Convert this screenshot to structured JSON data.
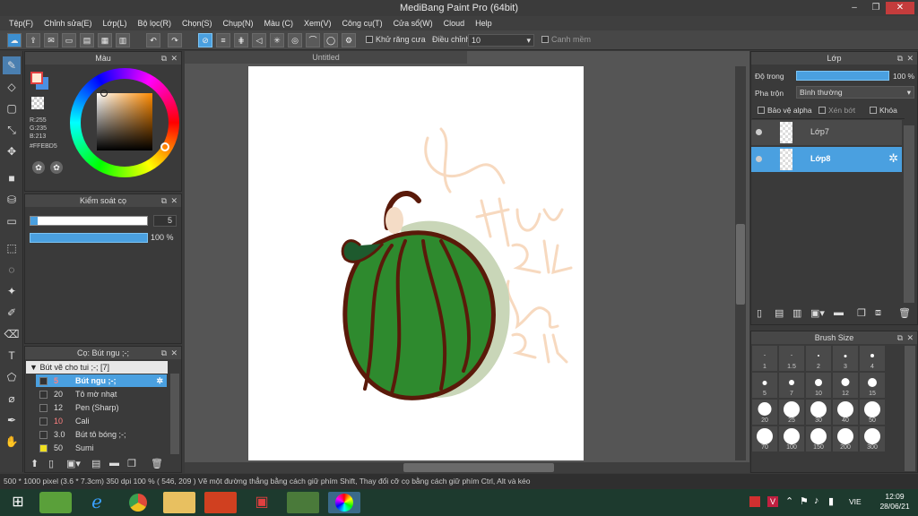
{
  "window": {
    "title": "MediBang Paint Pro (64bit)",
    "min": "–",
    "max": "❐",
    "close": "✕"
  },
  "menu": [
    "Tệp(F)",
    "Chỉnh sửa(E)",
    "Lớp(L)",
    "Bộ lọc(R)",
    "Chọn(S)",
    "Chụp(N)",
    "Màu (C)",
    "Xem(V)",
    "Công cụ(T)",
    "Cửa sổ(W)",
    "Cloud",
    "Help"
  ],
  "toolbar": {
    "antialias_label": "Khử răng cưa",
    "adjust_label": "Điều chỉnh",
    "adjust_value": "10",
    "align_label": "Canh mềm"
  },
  "color_panel": {
    "title": "Màu",
    "r": "R:255",
    "g": "G:235",
    "b": "B:213",
    "hex": "#FFEBD5",
    "fg": "#ffebd5",
    "bg": "#e04040"
  },
  "brush_control": {
    "title": "Kiểm soát cọ",
    "size_value": "5",
    "opacity_value": "100 %"
  },
  "brush_panel": {
    "title": "Cọ: Bút ngu ;-;",
    "group": "Bút vẽ cho tui ;-; [7]",
    "brushes": [
      {
        "size": "5",
        "name": "Bút ngu ;-;",
        "selected": true,
        "size_color": "#ff8080"
      },
      {
        "size": "20",
        "name": "Tô mờ nhạt",
        "selected": false,
        "size_color": "#dddddd"
      },
      {
        "size": "12",
        "name": "Pen (Sharp)",
        "selected": false,
        "size_color": "#dddddd"
      },
      {
        "size": "10",
        "name": "Cali",
        "selected": false,
        "size_color": "#ff8080"
      },
      {
        "size": "3.0",
        "name": "Bút tô bóng ;-;",
        "selected": false,
        "size_color": "#dddddd"
      },
      {
        "size": "50",
        "name": "Sumi",
        "selected": false,
        "size_color": "#dddddd"
      }
    ]
  },
  "document": {
    "tab": "Untitled"
  },
  "layer_panel": {
    "title": "Lớp",
    "opacity_label": "Độ trong",
    "opacity_value": "100 %",
    "blend_label": "Pha trộn",
    "blend_value": "Bình thường",
    "protect_alpha": "Bảo vệ alpha",
    "clip": "Xén bớt",
    "lock": "Khóa",
    "layers": [
      {
        "name": "Lớp7",
        "selected": false
      },
      {
        "name": "Lớp8",
        "selected": true
      }
    ]
  },
  "brush_size_panel": {
    "title": "Brush Size",
    "sizes": [
      "1",
      "1.5",
      "2",
      "3",
      "4",
      "5",
      "7",
      "10",
      "12",
      "15",
      "20",
      "25",
      "30",
      "40",
      "50",
      "70",
      "100",
      "150",
      "200",
      "300"
    ]
  },
  "status": {
    "text": "500 * 1000 pixel   (3.6 * 7.3cm)   350 dpi   100 %   ( 546, 209 )   Vẽ một đường thẳng bằng cách giữ phím Shift, Thay đổi cỡ cọ bằng cách giữ phím Ctrl, Alt và kéo"
  },
  "taskbar": {
    "lang": "VIE",
    "time": "12:09",
    "date": "28/06/21"
  },
  "colors": {
    "accent": "#4aa0e0",
    "green_drawing": "#2e8a2e",
    "brown_outline": "#5a1a0a"
  }
}
